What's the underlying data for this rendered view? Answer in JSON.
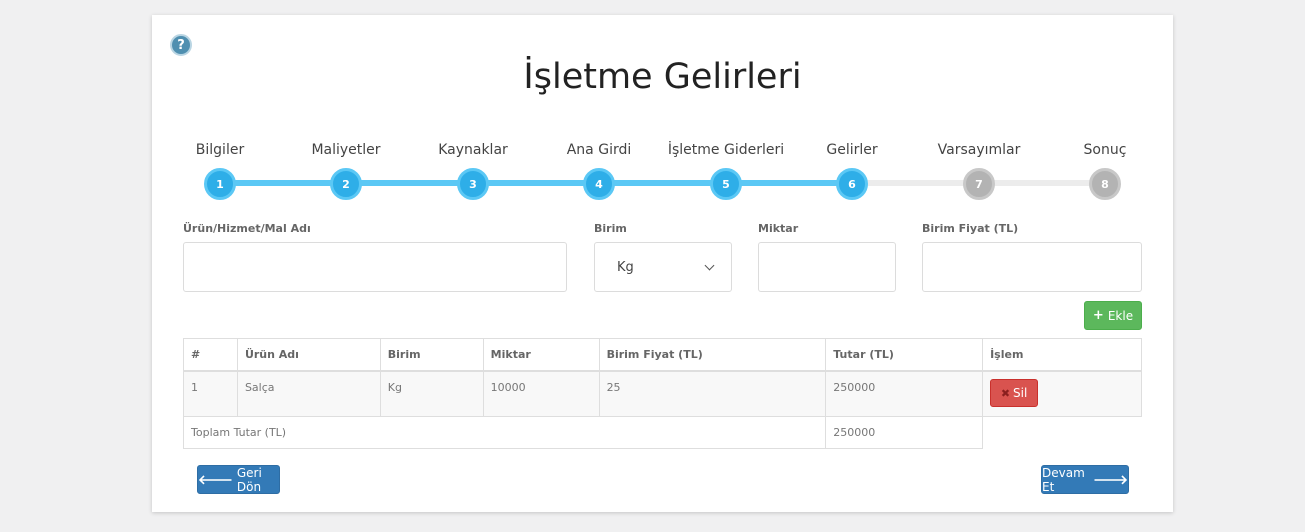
{
  "page": {
    "help_icon": "question-circle-icon",
    "title": "İşletme Gelirleri"
  },
  "steps": [
    {
      "label": "Bilgiler",
      "num": "1",
      "active": true
    },
    {
      "label": "Maliyetler",
      "num": "2",
      "active": true
    },
    {
      "label": "Kaynaklar",
      "num": "3",
      "active": true
    },
    {
      "label": "Ana Girdi",
      "num": "4",
      "active": true
    },
    {
      "label": "İşletme Giderleri",
      "num": "5",
      "active": true
    },
    {
      "label": "Gelirler",
      "num": "6",
      "active": true
    },
    {
      "label": "Varsayımlar",
      "num": "7",
      "active": false
    },
    {
      "label": "Sonuç",
      "num": "8",
      "active": false
    }
  ],
  "form": {
    "name_label": "Ürün/Hizmet/Mal Adı",
    "name_value": "",
    "unit_label": "Birim",
    "unit_value": "Kg",
    "qty_label": "Miktar",
    "qty_value": "",
    "price_label": "Birim Fiyat (TL)",
    "price_value": "",
    "add_label": "Ekle"
  },
  "table": {
    "headers": [
      "#",
      "Ürün Adı",
      "Birim",
      "Miktar",
      "Birim Fiyat (TL)",
      "Tutar (TL)",
      "İşlem"
    ],
    "rows": [
      {
        "no": "1",
        "name": "Salça",
        "unit": "Kg",
        "qty": "10000",
        "price": "25",
        "total": "250000",
        "action": "Sil"
      }
    ],
    "total_label": "Toplam Tutar (TL)",
    "total_value": "250000"
  },
  "nav": {
    "back_label": "Geri Dön",
    "next_label": "Devam Et"
  },
  "colors": {
    "progress_active": "#5bc8f5",
    "progress_inactive": "#b3b3b3",
    "add_button": "#5cb85c",
    "delete_button": "#d9534f",
    "nav_button": "#337ab7"
  }
}
